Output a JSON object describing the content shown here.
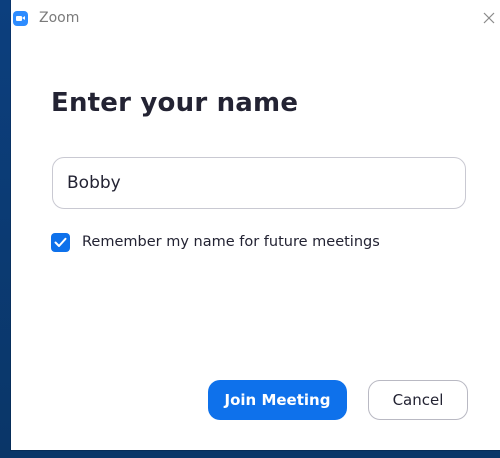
{
  "window": {
    "app_title": "Zoom",
    "app_icon": "zoom-camera-icon",
    "close_icon": "close-icon"
  },
  "dialog": {
    "heading": "Enter your name",
    "name_input": {
      "value": "Bobby",
      "placeholder": ""
    },
    "remember_checkbox": {
      "label": "Remember my name for future meetings",
      "checked": true
    },
    "join_button_label": "Join Meeting",
    "cancel_button_label": "Cancel"
  },
  "colors": {
    "accent": "#0e71eb",
    "app_icon": "#2d8cff",
    "text": "#232333",
    "desktop": "#0b3a73"
  }
}
